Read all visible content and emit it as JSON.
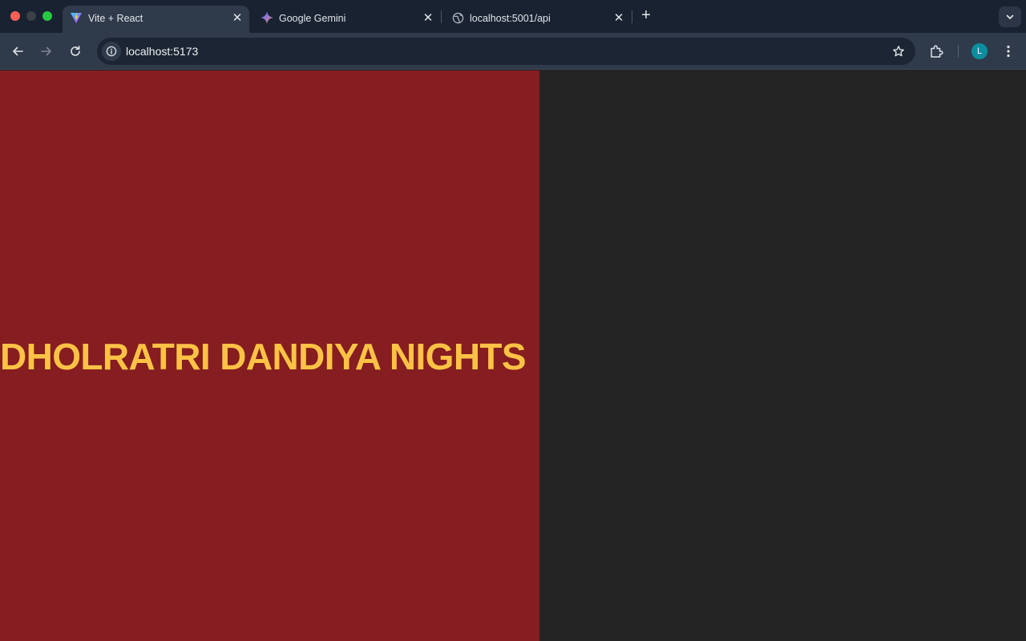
{
  "browser": {
    "tabs": [
      {
        "title": "Vite + React",
        "icon": "vite-icon",
        "active": true
      },
      {
        "title": "Google Gemini",
        "icon": "gemini-icon",
        "active": false
      },
      {
        "title": "localhost:5001/api",
        "icon": "globe-icon",
        "active": false
      }
    ],
    "address_bar": {
      "url": "localhost:5173"
    },
    "profile_initial": "L",
    "colors": {
      "accent_avatar": "#0a8f9e",
      "chrome": "#182231",
      "toolbar": "#2f3b4b"
    }
  },
  "page": {
    "heading": "DHOLRATRI DANDIYA NIGHTS",
    "colors": {
      "hero_bg": "#861d20",
      "heading": "#fcc245",
      "right_bg": "#232323"
    }
  }
}
